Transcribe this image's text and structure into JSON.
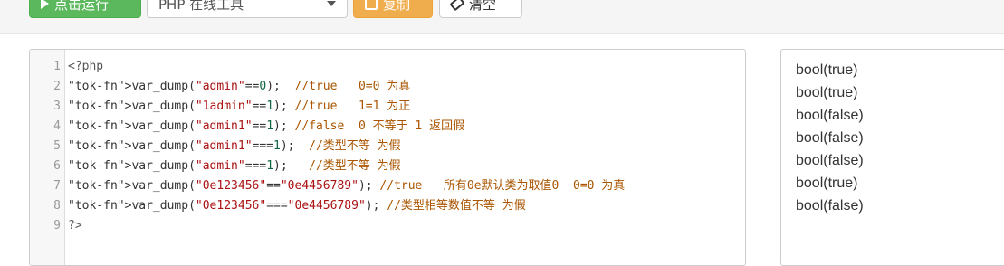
{
  "toolbar": {
    "run_label": "点击运行",
    "language_select": "PHP 在线工具",
    "copy_label": "复制",
    "clear_label": "清空"
  },
  "editor": {
    "lines": [
      {
        "n": "1",
        "code": "<?php"
      },
      {
        "n": "2",
        "code": "var_dump(\"admin\"==0);  //true   0=0 为真"
      },
      {
        "n": "3",
        "code": "var_dump(\"1admin\"==1); //true   1=1 为正"
      },
      {
        "n": "4",
        "code": "var_dump(\"admin1\"==1); //false  0 不等于 1 返回假"
      },
      {
        "n": "5",
        "code": "var_dump(\"admin1\"===1);  //类型不等 为假"
      },
      {
        "n": "6",
        "code": "var_dump(\"admin\"===1);   //类型不等 为假"
      },
      {
        "n": "7",
        "code": "var_dump(\"0e123456\"==\"0e4456789\"); //true   所有0e默认类为取值0  0=0 为真"
      },
      {
        "n": "8",
        "code": "var_dump(\"0e123456\"===\"0e4456789\"); //类型相等数值不等 为假"
      },
      {
        "n": "9",
        "code": "?>"
      }
    ]
  },
  "output": {
    "lines": [
      "bool(true)",
      "bool(true)",
      "bool(false)",
      "bool(false)",
      "bool(false)",
      "bool(true)",
      "bool(false)"
    ]
  },
  "colors": {
    "run_button": "#5cb85c",
    "copy_button": "#f0ad4e",
    "comment": "#aa5500",
    "string": "#aa1111",
    "function": "#0000cc"
  }
}
